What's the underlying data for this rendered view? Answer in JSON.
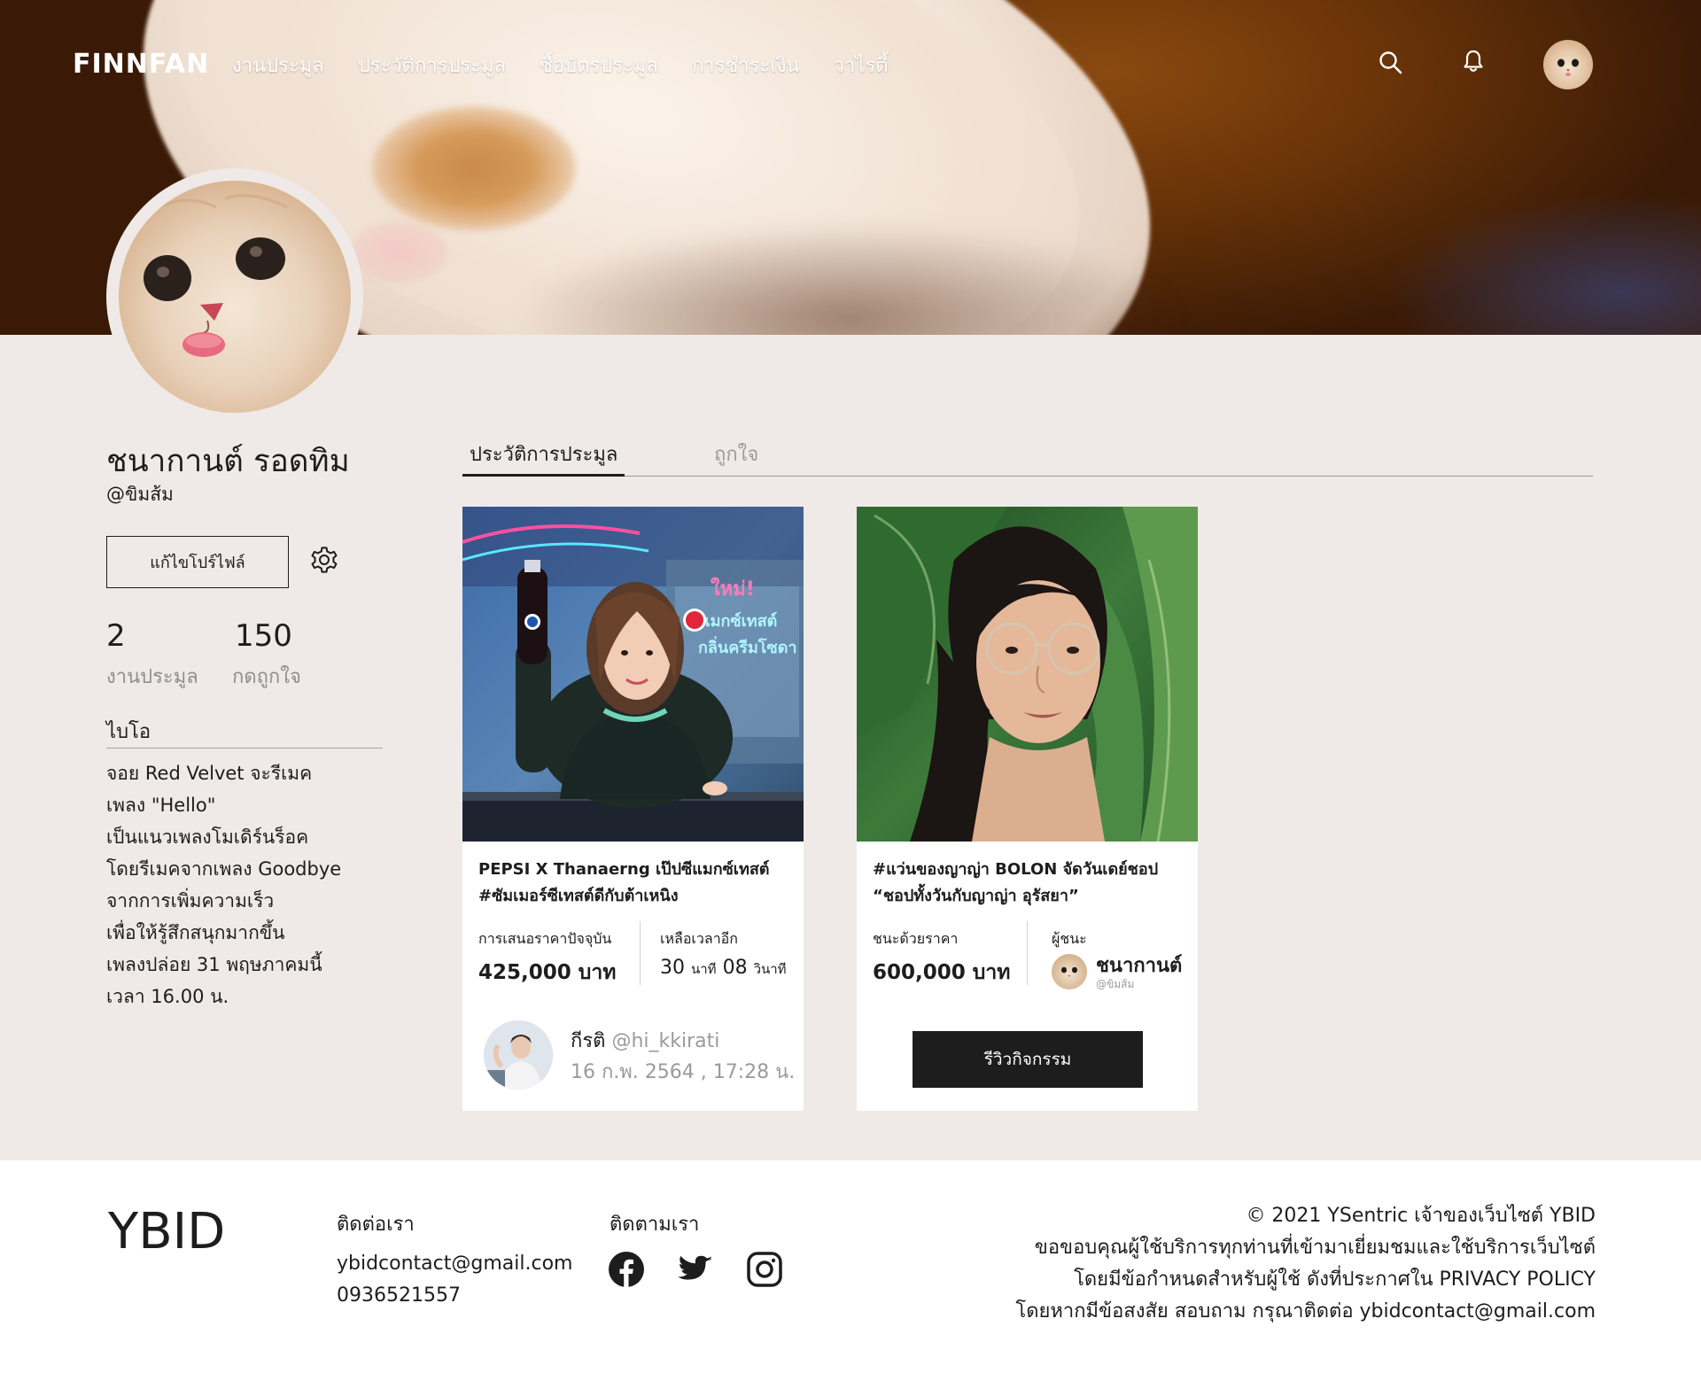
{
  "nav": {
    "logo": "FINNFAN",
    "links": [
      "งานประมูล",
      "ประวัติการประมูล",
      "ซื้อบัตรประมูล",
      "การชำระเงิน",
      "วาไรตี้"
    ],
    "search_icon": "search-icon",
    "bell_icon": "bell-icon"
  },
  "profile": {
    "name": "ชนากานต์ รอดทิม",
    "handle": "@ขิมส้ม",
    "edit_label": "แก้ไขโปร์ไฟล์",
    "stats": [
      {
        "value": "2",
        "label": "งานประมูล"
      },
      {
        "value": "150",
        "label": "กดถูกใจ"
      }
    ],
    "bio_title": "ไบโอ",
    "bio_lines": [
      "จอย Red Velvet จะรีเมค",
      "เพลง \"Hello\"",
      "เป็นแนวเพลงโมเดิร์นร็อค",
      "โดยรีเมคจากเพลง Goodbye",
      "จากการเพิ่มความเร็ว",
      "เพื่อให้รู้สึกสนุกมากขึ้น",
      "เพลงปล่อย 31 พฤษภาคมนี้",
      "เวลา 16.00 น."
    ]
  },
  "tabs": [
    "ประวัติการประมูล",
    "ถูกใจ"
  ],
  "cards": [
    {
      "title_lines": [
        "PEPSI X Thanaerng เป๊ปซีแมกซ์เทสต์",
        "#ซัมเมอร์ซีเทสต์ดีกับต้าเหนิง"
      ],
      "price_label": "การเสนอราคาปัจจุบัน",
      "price": "425,000 บาท",
      "time_label": "เหลือเวลาอีก",
      "time_min": "30",
      "time_min_unit": "นาที",
      "time_sec": "08",
      "time_sec_unit": "วินาที",
      "bidder_name": "กีรติ",
      "bidder_handle": "@hi_kkirati",
      "bid_date": "16 ก.พ. 2564 , 17:28 น."
    },
    {
      "title_lines": [
        "#แว่นของญาญ่า BOLON จัดวันเดย์ชอป",
        "“ชอปทั้งวันกับญาญ่า อุรัสยา”"
      ],
      "price_label": "ชนะด้วยราคา",
      "price": "600,000 บาท",
      "winner_label": "ผู้ชนะ",
      "winner_name": "ชนากานต์",
      "winner_handle": "@ขิมส้ม",
      "review_label": "รีวิวกิจกรรม"
    }
  ],
  "footer": {
    "logo": "YBID",
    "contact_title": "ติดต่อเรา",
    "email": "ybidcontact@gmail.com",
    "phone": "0936521557",
    "follow_title": "ติดตามเรา",
    "socials": [
      "facebook-icon",
      "twitter-icon",
      "instagram-icon"
    ],
    "legal_lines": [
      "© 2021 YSentric เจ้าของเว็บไซต์ YBID",
      "ขอขอบคุณผู้ใช้บริการทุกท่านที่เข้ามาเยี่ยมชมและใช้บริการเว็บไซต์",
      "โดยมีข้อกำหนดสำหรับผู้ใช้ ดังที่ประกาศใน PRIVACY POLICY",
      "โดยหากมีข้อสงสัย สอบถาม กรุณาติดต่อ ybidcontact@gmail.com"
    ]
  }
}
